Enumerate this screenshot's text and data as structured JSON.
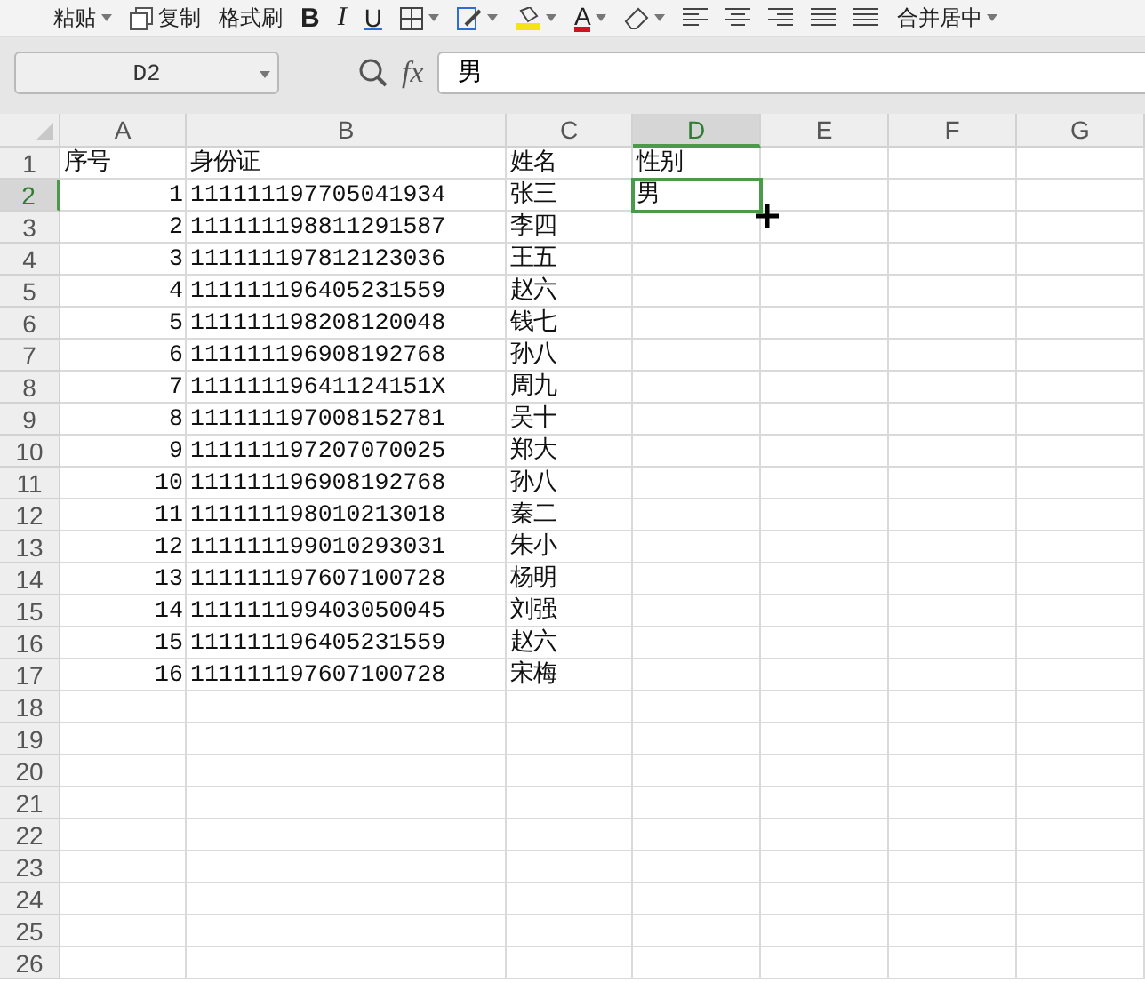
{
  "toolbar": [
    {
      "kind": "text",
      "label": "粘贴",
      "caret": true
    },
    {
      "kind": "copy",
      "label": "复制",
      "caret": false
    },
    {
      "kind": "text",
      "label": "格式刷",
      "caret": false
    },
    {
      "kind": "bold",
      "label": "B",
      "caret": false
    },
    {
      "kind": "italic",
      "label": "I",
      "caret": false
    },
    {
      "kind": "underline",
      "label": "U",
      "caret": false
    },
    {
      "kind": "borders",
      "caret": true
    },
    {
      "kind": "cell-style",
      "caret": true
    },
    {
      "kind": "fill",
      "caret": true
    },
    {
      "kind": "font-color",
      "label": "A",
      "caret": true
    },
    {
      "kind": "eraser",
      "caret": true
    },
    {
      "kind": "align-left",
      "caret": false
    },
    {
      "kind": "align-center",
      "caret": false
    },
    {
      "kind": "align-right",
      "caret": false
    },
    {
      "kind": "justify",
      "caret": false
    },
    {
      "kind": "distribute",
      "caret": false
    },
    {
      "kind": "text",
      "label": "合并居中",
      "caret": true
    }
  ],
  "formula_bar": {
    "name_box": "D2",
    "fx_label": "fx",
    "formula": "男"
  },
  "columns": [
    {
      "label": "A",
      "selected": false
    },
    {
      "label": "B",
      "selected": false
    },
    {
      "label": "C",
      "selected": false
    },
    {
      "label": "D",
      "selected": true
    },
    {
      "label": "E",
      "selected": false
    },
    {
      "label": "F",
      "selected": false
    },
    {
      "label": "G",
      "selected": false
    }
  ],
  "rows": [
    {
      "header": "1",
      "selected": false,
      "cells": [
        {
          "text": "序号",
          "kind": "text"
        },
        {
          "text": "身份证",
          "kind": "text"
        },
        {
          "text": "姓名",
          "kind": "text"
        },
        {
          "text": "性别",
          "kind": "text"
        }
      ]
    },
    {
      "header": "2",
      "selected": true,
      "cells": [
        {
          "text": "1",
          "kind": "number"
        },
        {
          "text": "111111197705041934",
          "kind": "text"
        },
        {
          "text": "张三",
          "kind": "text"
        },
        {
          "text": "男",
          "kind": "text"
        }
      ]
    },
    {
      "header": "3",
      "selected": false,
      "cells": [
        {
          "text": "2",
          "kind": "number"
        },
        {
          "text": "111111198811291587",
          "kind": "text"
        },
        {
          "text": "李四",
          "kind": "text"
        }
      ]
    },
    {
      "header": "4",
      "selected": false,
      "cells": [
        {
          "text": "3",
          "kind": "number"
        },
        {
          "text": "111111197812123036",
          "kind": "text"
        },
        {
          "text": "王五",
          "kind": "text"
        }
      ]
    },
    {
      "header": "5",
      "selected": false,
      "cells": [
        {
          "text": "4",
          "kind": "number"
        },
        {
          "text": "111111196405231559",
          "kind": "text"
        },
        {
          "text": "赵六",
          "kind": "text"
        }
      ]
    },
    {
      "header": "6",
      "selected": false,
      "cells": [
        {
          "text": "5",
          "kind": "number"
        },
        {
          "text": "111111198208120048",
          "kind": "text"
        },
        {
          "text": "钱七",
          "kind": "text"
        }
      ]
    },
    {
      "header": "7",
      "selected": false,
      "cells": [
        {
          "text": "6",
          "kind": "number"
        },
        {
          "text": "111111196908192768",
          "kind": "text"
        },
        {
          "text": "孙八",
          "kind": "text"
        }
      ]
    },
    {
      "header": "8",
      "selected": false,
      "cells": [
        {
          "text": "7",
          "kind": "number"
        },
        {
          "text": "11111119641124151X",
          "kind": "text"
        },
        {
          "text": "周九",
          "kind": "text"
        }
      ]
    },
    {
      "header": "9",
      "selected": false,
      "cells": [
        {
          "text": "8",
          "kind": "number"
        },
        {
          "text": "111111197008152781",
          "kind": "text"
        },
        {
          "text": "吴十",
          "kind": "text"
        }
      ]
    },
    {
      "header": "10",
      "selected": false,
      "cells": [
        {
          "text": "9",
          "kind": "number"
        },
        {
          "text": "111111197207070025",
          "kind": "text"
        },
        {
          "text": "郑大",
          "kind": "text"
        }
      ]
    },
    {
      "header": "11",
      "selected": false,
      "cells": [
        {
          "text": "10",
          "kind": "number"
        },
        {
          "text": "111111196908192768",
          "kind": "text"
        },
        {
          "text": "孙八",
          "kind": "text"
        }
      ]
    },
    {
      "header": "12",
      "selected": false,
      "cells": [
        {
          "text": "11",
          "kind": "number"
        },
        {
          "text": "111111198010213018",
          "kind": "text"
        },
        {
          "text": "秦二",
          "kind": "text"
        }
      ]
    },
    {
      "header": "13",
      "selected": false,
      "cells": [
        {
          "text": "12",
          "kind": "number"
        },
        {
          "text": "111111199010293031",
          "kind": "text"
        },
        {
          "text": "朱小",
          "kind": "text"
        }
      ]
    },
    {
      "header": "14",
      "selected": false,
      "cells": [
        {
          "text": "13",
          "kind": "number"
        },
        {
          "text": "111111197607100728",
          "kind": "text"
        },
        {
          "text": "杨明",
          "kind": "text"
        }
      ]
    },
    {
      "header": "15",
      "selected": false,
      "cells": [
        {
          "text": "14",
          "kind": "number"
        },
        {
          "text": "111111199403050045",
          "kind": "text"
        },
        {
          "text": "刘强",
          "kind": "text"
        }
      ]
    },
    {
      "header": "16",
      "selected": false,
      "cells": [
        {
          "text": "15",
          "kind": "number"
        },
        {
          "text": "111111196405231559",
          "kind": "text"
        },
        {
          "text": "赵六",
          "kind": "text"
        }
      ]
    },
    {
      "header": "17",
      "selected": false,
      "cells": [
        {
          "text": "16",
          "kind": "number"
        },
        {
          "text": "111111197607100728",
          "kind": "text"
        },
        {
          "text": "宋梅",
          "kind": "text"
        }
      ]
    },
    {
      "header": "18",
      "selected": false,
      "cells": []
    },
    {
      "header": "19",
      "selected": false,
      "cells": []
    },
    {
      "header": "20",
      "selected": false,
      "cells": []
    },
    {
      "header": "21",
      "selected": false,
      "cells": []
    },
    {
      "header": "22",
      "selected": false,
      "cells": []
    },
    {
      "header": "23",
      "selected": false,
      "cells": []
    },
    {
      "header": "24",
      "selected": false,
      "cells": []
    },
    {
      "header": "25",
      "selected": false,
      "cells": []
    },
    {
      "header": "26",
      "selected": false,
      "cells": []
    }
  ]
}
